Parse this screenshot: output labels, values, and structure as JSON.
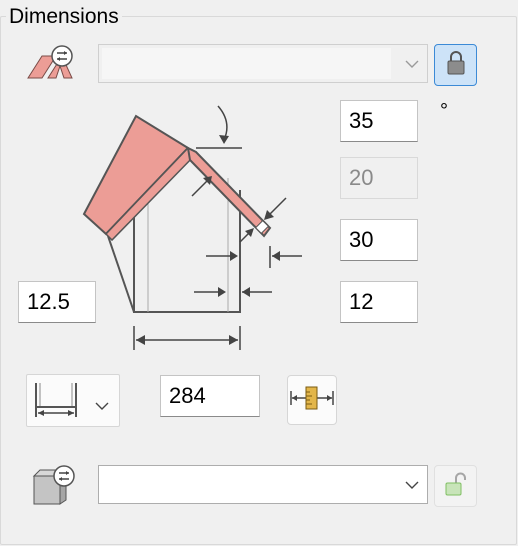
{
  "group": {
    "title": "Dimensions"
  },
  "profile": {
    "selected": ""
  },
  "angle": {
    "value": "35",
    "unit": "°"
  },
  "fields": {
    "overhang_top": "20",
    "thickness": "30",
    "left_offset": "12.5",
    "right_offset": "12"
  },
  "width": {
    "value": "284",
    "dropdown_selected": ""
  },
  "material": {
    "selected": ""
  },
  "icons": {
    "roof_profile": "roof-settings-icon",
    "lock_closed": "lock-icon",
    "lock_open": "unlock-icon",
    "measure": "measure-tool-icon",
    "width_type": "width-dimension-icon",
    "box_material": "box-settings-icon"
  },
  "colors": {
    "roof_fill": "#ec9d96",
    "accent_blue": "#3c8ad6",
    "lock_open_green": "#7fbf62"
  }
}
